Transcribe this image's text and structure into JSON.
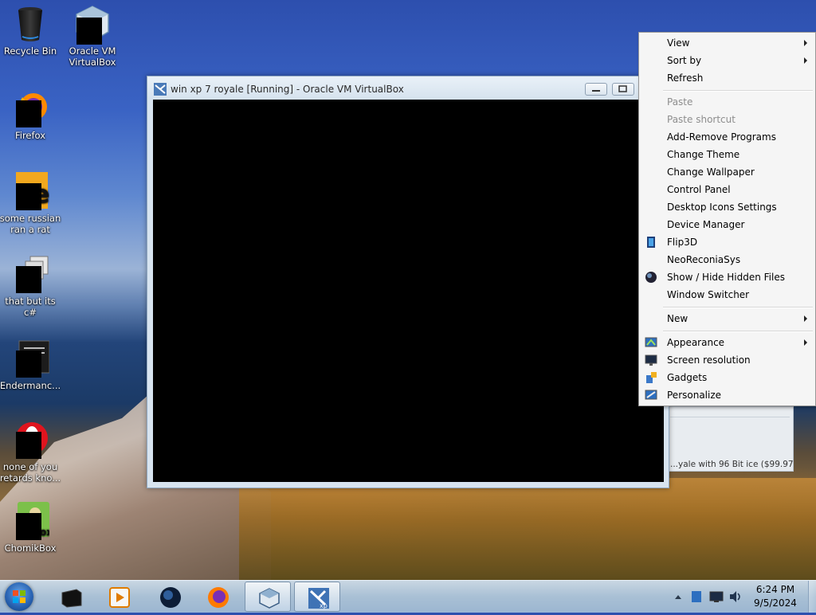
{
  "desktop": {
    "icons": [
      {
        "label": "Recycle Bin",
        "icon": "recycle-bin-icon"
      },
      {
        "label": "Oracle VM VirtualBox",
        "icon": "virtualbox-icon"
      },
      {
        "label": "Firefox",
        "icon": "firefox-icon"
      },
      {
        "label": "some russian ran a rat",
        "icon": "file-icon"
      },
      {
        "label": "that but its c#",
        "icon": "shortcut-icon"
      },
      {
        "label": "Endermanc...",
        "icon": "app-window-icon"
      },
      {
        "label": "none of you retards kno...",
        "icon": "opera-icon"
      },
      {
        "label": "ChomikBox",
        "icon": "chomikbox-icon"
      }
    ]
  },
  "vbox_window": {
    "title": "win xp 7 royale [Running] - Oracle VM VirtualBox"
  },
  "behind_window": {
    "text": "...yale with 96 Bit ice ($99.97"
  },
  "context_menu": {
    "items": [
      {
        "label": "View",
        "submenu": true
      },
      {
        "label": "Sort by",
        "submenu": true
      },
      {
        "label": "Refresh"
      },
      {
        "label": "Paste",
        "disabled": true
      },
      {
        "label": "Paste shortcut",
        "disabled": true
      },
      {
        "label": "Add-Remove Programs"
      },
      {
        "label": "Change Theme"
      },
      {
        "label": "Change Wallpaper"
      },
      {
        "label": "Control Panel"
      },
      {
        "label": "Desktop Icons Settings"
      },
      {
        "label": "Device Manager"
      },
      {
        "label": "Flip3D",
        "icon": "flip3d-icon"
      },
      {
        "label": "NeoReconiaSys"
      },
      {
        "label": "Show / Hide Hidden Files",
        "icon": "globe-icon"
      },
      {
        "label": "Window Switcher"
      },
      {
        "label": "New",
        "submenu": true
      },
      {
        "label": "Appearance",
        "submenu": true,
        "icon": "appearance-icon"
      },
      {
        "label": "Screen resolution",
        "icon": "monitor-icon"
      },
      {
        "label": "Gadgets",
        "icon": "gadgets-icon"
      },
      {
        "label": "Personalize",
        "icon": "personalize-icon"
      }
    ]
  },
  "taskbar": {
    "clock_time": "6:24 PM",
    "clock_date": "9/5/2024",
    "pinned": [
      "black-box-app-icon",
      "media-player-icon",
      "globe-app-icon",
      "firefox-icon",
      "virtualbox-icon",
      "xp-vm-icon"
    ]
  },
  "colors": {
    "menu_bg": "#f5f5f5",
    "disabled_text": "#8d8d8d",
    "taskbar": "#b0cae4"
  }
}
